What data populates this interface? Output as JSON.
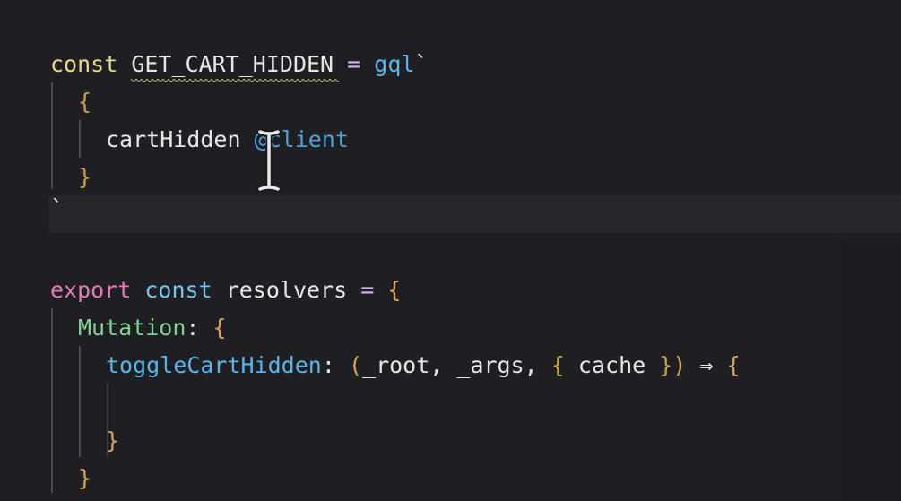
{
  "code": {
    "line1": {
      "kw": "const",
      "name": "GET_CART_HIDDEN",
      "eq": "=",
      "tag": "gql",
      "tick": "`"
    },
    "line2": {
      "brace": "{"
    },
    "line3": {
      "field": "cartHidden",
      "directive": "@client"
    },
    "line4": {
      "brace": "}"
    },
    "line5": {
      "tick": "`"
    },
    "line6": {
      "export": "export",
      "kw": "const",
      "name": "resolvers",
      "eq": "=",
      "brace": "{"
    },
    "line7": {
      "key": "Mutation",
      "colon": ":",
      "brace": "{"
    },
    "line8": {
      "fn": "toggleCartHidden",
      "colon": ":",
      "open_paren": "(",
      "arg1": "_root",
      "comma1": ",",
      "arg2": "_args",
      "comma2": ",",
      "lbrace": "{",
      "arg3": "cache",
      "rbrace": "}",
      "close_paren": ")",
      "arrow": "⇒",
      "body_brace": "{"
    },
    "line9": {
      "brace": "}"
    },
    "line10": {
      "brace": "}"
    }
  },
  "colors": {
    "background": "#1f1f23",
    "keyword_const": "#e6da8a",
    "keyword_export": "#e57ab7",
    "function": "#5bb3e6",
    "property": "#7ed491",
    "brace": "#d9a35a"
  },
  "icons": {
    "cursor": "text-cursor-icon"
  }
}
